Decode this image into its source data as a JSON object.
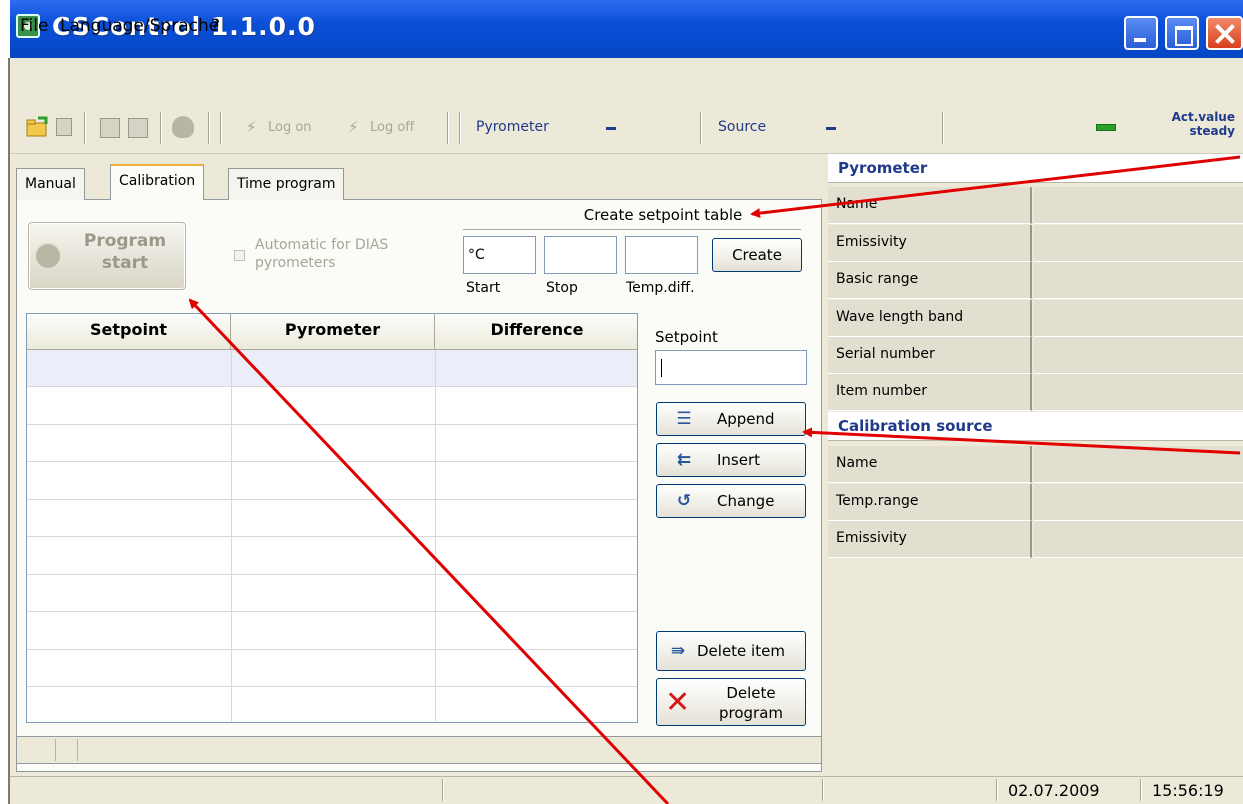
{
  "window": {
    "title": "CSControl  1.1.0.0"
  },
  "menu": {
    "items": [
      "File",
      "Language/Sprache",
      "?"
    ]
  },
  "toolbar": {
    "log_on": "Log on",
    "log_off": "Log off",
    "pyrometer_label": "Pyrometer",
    "source_label": "Source",
    "act_value": "Act.value steady",
    "indicator_color": "#2aa12a"
  },
  "tabs": [
    {
      "label": "Manual",
      "active": false
    },
    {
      "label": "Calibration",
      "active": true
    },
    {
      "label": "Time program",
      "active": false
    }
  ],
  "calibration": {
    "program_start": "Program start",
    "automatic_label": "Automatic for DIAS pyrometers",
    "automatic_checked": false,
    "create_table_title": "Create setpoint table",
    "start_value": "°C",
    "stop_value": "",
    "tempdiff_value": "",
    "start_caption": "Start",
    "stop_caption": "Stop",
    "tempdiff_caption": "Temp.diff.",
    "create_button": "Create",
    "setpoint_label": "Setpoint",
    "setpoint_value": "",
    "append_button": "Append",
    "insert_button": "Insert",
    "change_button": "Change",
    "delete_item_button": "Delete item",
    "delete_program_button": "Delete program"
  },
  "table": {
    "columns": [
      "Setpoint",
      "Pyrometer",
      "Difference"
    ],
    "row_count": 10
  },
  "pyrometer_info": {
    "title": "Pyrometer",
    "rows": [
      {
        "label": "Name",
        "value": ""
      },
      {
        "label": "Emissivity",
        "value": ""
      },
      {
        "label": "Basic range",
        "value": ""
      },
      {
        "label": "Wave length band",
        "value": ""
      },
      {
        "label": "Serial number",
        "value": ""
      },
      {
        "label": "Item number",
        "value": ""
      }
    ]
  },
  "source_info": {
    "title": "Calibration source",
    "rows": [
      {
        "label": "Name",
        "value": ""
      },
      {
        "label": "Temp.range",
        "value": ""
      },
      {
        "label": "Emissivity",
        "value": ""
      }
    ]
  },
  "statusbar": {
    "date": "02.07.2009",
    "time": "15:56:19"
  },
  "annotation_color": "#e00000"
}
